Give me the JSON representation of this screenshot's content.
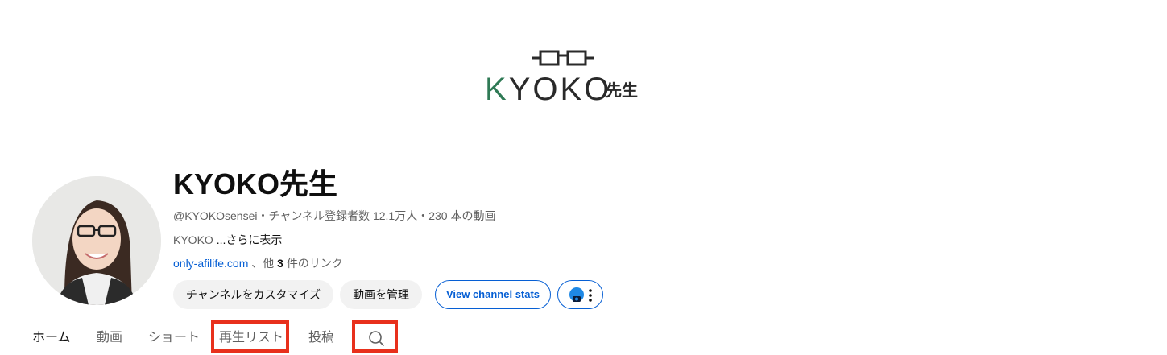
{
  "banner": {
    "logo_word_k": "K",
    "logo_word_rest": "YOKO",
    "logo_sensei": "先生"
  },
  "channel": {
    "name": "KYOKO先生",
    "meta": "@KYOKOsensei・チャンネル登録者数 12.1万人・230 本の動画",
    "description_text": "KYOKO",
    "description_more": "...さらに表示",
    "link_text": "only-afilife.com",
    "link_suffix_pre": "、他 ",
    "link_count": "3",
    "link_suffix_post": " 件のリンク"
  },
  "buttons": {
    "customize": "チャンネルをカスタマイズ",
    "manage": "動画を管理",
    "stats": "View channel stats"
  },
  "tabs": {
    "home": "ホーム",
    "videos": "動画",
    "shorts": "ショート",
    "playlists": "再生リスト",
    "posts": "投稿"
  },
  "colors": {
    "accent_link": "#065fd4",
    "highlight": "#e8301c",
    "logo_green": "#2f7a55"
  },
  "icons": {
    "search": "search-icon",
    "more": "more-vert-icon",
    "glasses": "glasses-icon"
  }
}
